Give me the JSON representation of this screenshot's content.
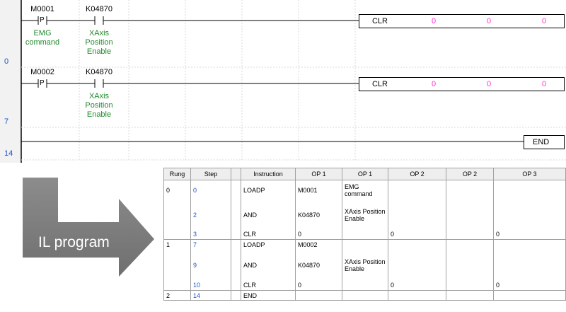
{
  "ladder": {
    "rungs": [
      {
        "number": "0",
        "contacts": [
          {
            "address": "M0001",
            "symbol": "P",
            "comment": [
              "EMG",
              "command"
            ]
          },
          {
            "address": "K04870",
            "symbol": "",
            "comment": [
              "XAxis",
              "Position",
              "Enable"
            ]
          }
        ],
        "instruction": "CLR",
        "operands": [
          "0",
          "0",
          "0"
        ]
      },
      {
        "number": "7",
        "contacts": [
          {
            "address": "M0002",
            "symbol": "P",
            "comment": []
          },
          {
            "address": "K04870",
            "symbol": "",
            "comment": [
              "XAxis",
              "Position",
              "Enable"
            ]
          }
        ],
        "instruction": "CLR",
        "operands": [
          "0",
          "0",
          "0"
        ]
      },
      {
        "number": "14",
        "instruction": "END"
      }
    ]
  },
  "arrow": {
    "label": "IL program",
    "color": "#7f7f7f"
  },
  "il_table": {
    "headers": [
      "Rung",
      "Step",
      "",
      "Instruction",
      "OP 1",
      "OP 1",
      "OP 2",
      "OP 2",
      "OP 3"
    ],
    "rows": [
      {
        "rung": "0",
        "step": "0",
        "instruction": "LOADP",
        "op1": "M0001",
        "op1_comment": "EMG command",
        "op2": "",
        "op2_comment": "",
        "op3": ""
      },
      {
        "rung": "",
        "step": "2",
        "instruction": "AND",
        "op1": "K04870",
        "op1_comment": "XAxis Position Enable",
        "op2": "",
        "op2_comment": "",
        "op3": ""
      },
      {
        "rung": "",
        "step": "3",
        "instruction": "CLR",
        "op1": "0",
        "op1_comment": "",
        "op2": "0",
        "op2_comment": "",
        "op3": "0"
      },
      {
        "rung": "1",
        "step": "7",
        "instruction": "LOADP",
        "op1": "M0002",
        "op1_comment": "",
        "op2": "",
        "op2_comment": "",
        "op3": ""
      },
      {
        "rung": "",
        "step": "9",
        "instruction": "AND",
        "op1": "K04870",
        "op1_comment": "XAxis Position Enable",
        "op2": "",
        "op2_comment": "",
        "op3": ""
      },
      {
        "rung": "",
        "step": "10",
        "instruction": "CLR",
        "op1": "0",
        "op1_comment": "",
        "op2": "0",
        "op2_comment": "",
        "op3": "0"
      },
      {
        "rung": "2",
        "step": "14",
        "instruction": "END",
        "op1": "",
        "op1_comment": "",
        "op2": "",
        "op2_comment": "",
        "op3": ""
      }
    ]
  },
  "colors": {
    "step_number": "#1a55c8",
    "comment": "#1f8a2c",
    "operand_value": "#ff33cc",
    "rail": "#e8e8e8"
  }
}
